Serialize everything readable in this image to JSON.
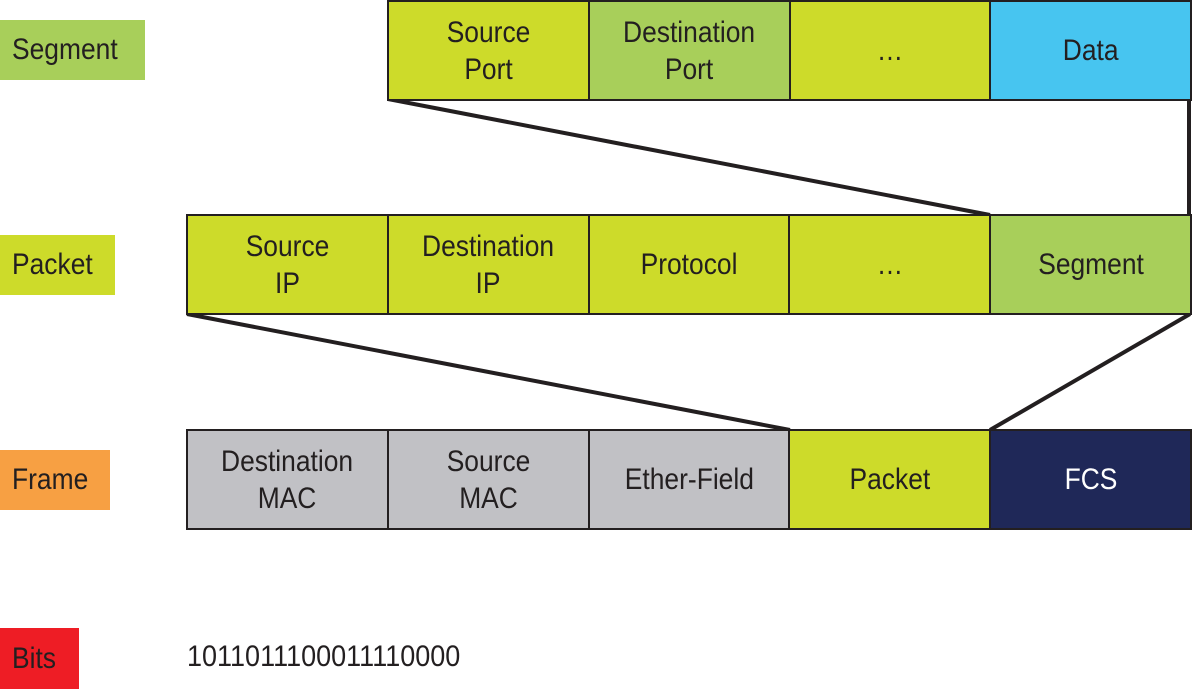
{
  "colors": {
    "yellow_green": "#cddb2a",
    "green": "#a8cf5a",
    "blue": "#47c5f0",
    "navy": "#1f2858",
    "gray": "#c1c1c5",
    "orange": "#f7a043",
    "red": "#ee1d25"
  },
  "labels": {
    "segment": "Segment",
    "packet": "Packet",
    "frame": "Frame",
    "bits": "Bits"
  },
  "segment_row": [
    "Source\nPort",
    "Destination\nPort",
    "…",
    "Data"
  ],
  "packet_row": [
    "Source\nIP",
    "Destination\nIP",
    "Protocol",
    "…",
    "Segment"
  ],
  "frame_row": [
    "Destination\nMAC",
    "Source\nMAC",
    "Ether-Field",
    "Packet",
    "FCS"
  ],
  "bits_value": "1011011100011110000"
}
